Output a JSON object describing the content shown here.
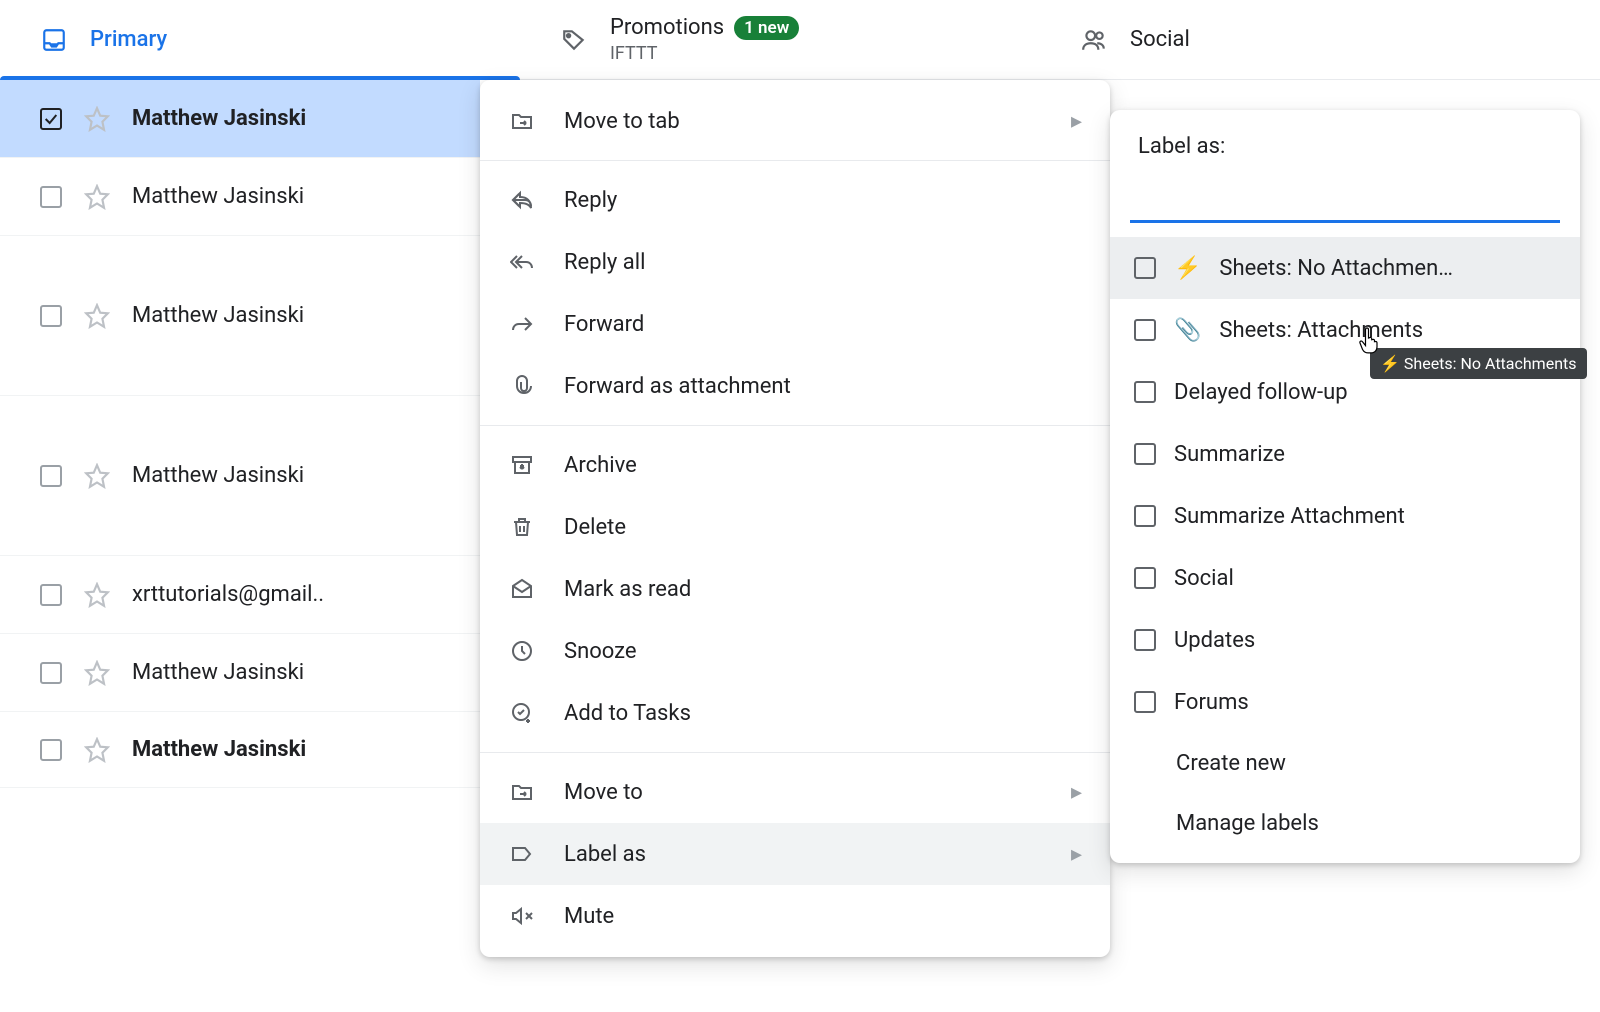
{
  "tabs": {
    "primary": {
      "label": "Primary"
    },
    "promotions": {
      "label": "Promotions",
      "badge": "1 new",
      "sub": "IFTTT"
    },
    "social": {
      "label": "Social"
    }
  },
  "emails": [
    {
      "sender": "Matthew Jasinski",
      "selected": true,
      "bold": true
    },
    {
      "sender": "Matthew Jasinski"
    },
    {
      "sender": "Matthew Jasinski"
    },
    {
      "sender": "Matthew Jasinski"
    },
    {
      "sender": "xrttutorials@gmail.."
    },
    {
      "sender": "Matthew Jasinski"
    },
    {
      "sender": "Matthew Jasinski",
      "bold": true
    }
  ],
  "contextMenu": {
    "moveToTab": "Move to tab",
    "reply": "Reply",
    "replyAll": "Reply all",
    "forward": "Forward",
    "forwardAttachment": "Forward as attachment",
    "archive": "Archive",
    "delete": "Delete",
    "markRead": "Mark as read",
    "snooze": "Snooze",
    "addTasks": "Add to Tasks",
    "moveTo": "Move to",
    "labelAs": "Label as",
    "mute": "Mute"
  },
  "labelMenu": {
    "header": "Label as:",
    "items": [
      {
        "emoji": "⚡",
        "text": "Sheets: No Attachmen…"
      },
      {
        "emoji": "📎",
        "text": "Sheets: Attachments"
      },
      {
        "text": "Delayed follow-up"
      },
      {
        "text": "Summarize"
      },
      {
        "text": "Summarize Attachment"
      },
      {
        "text": "Social"
      },
      {
        "text": "Updates"
      },
      {
        "text": "Forums"
      }
    ],
    "createNew": "Create new",
    "manage": "Manage labels"
  },
  "tooltip": "⚡ Sheets: No Attachments"
}
